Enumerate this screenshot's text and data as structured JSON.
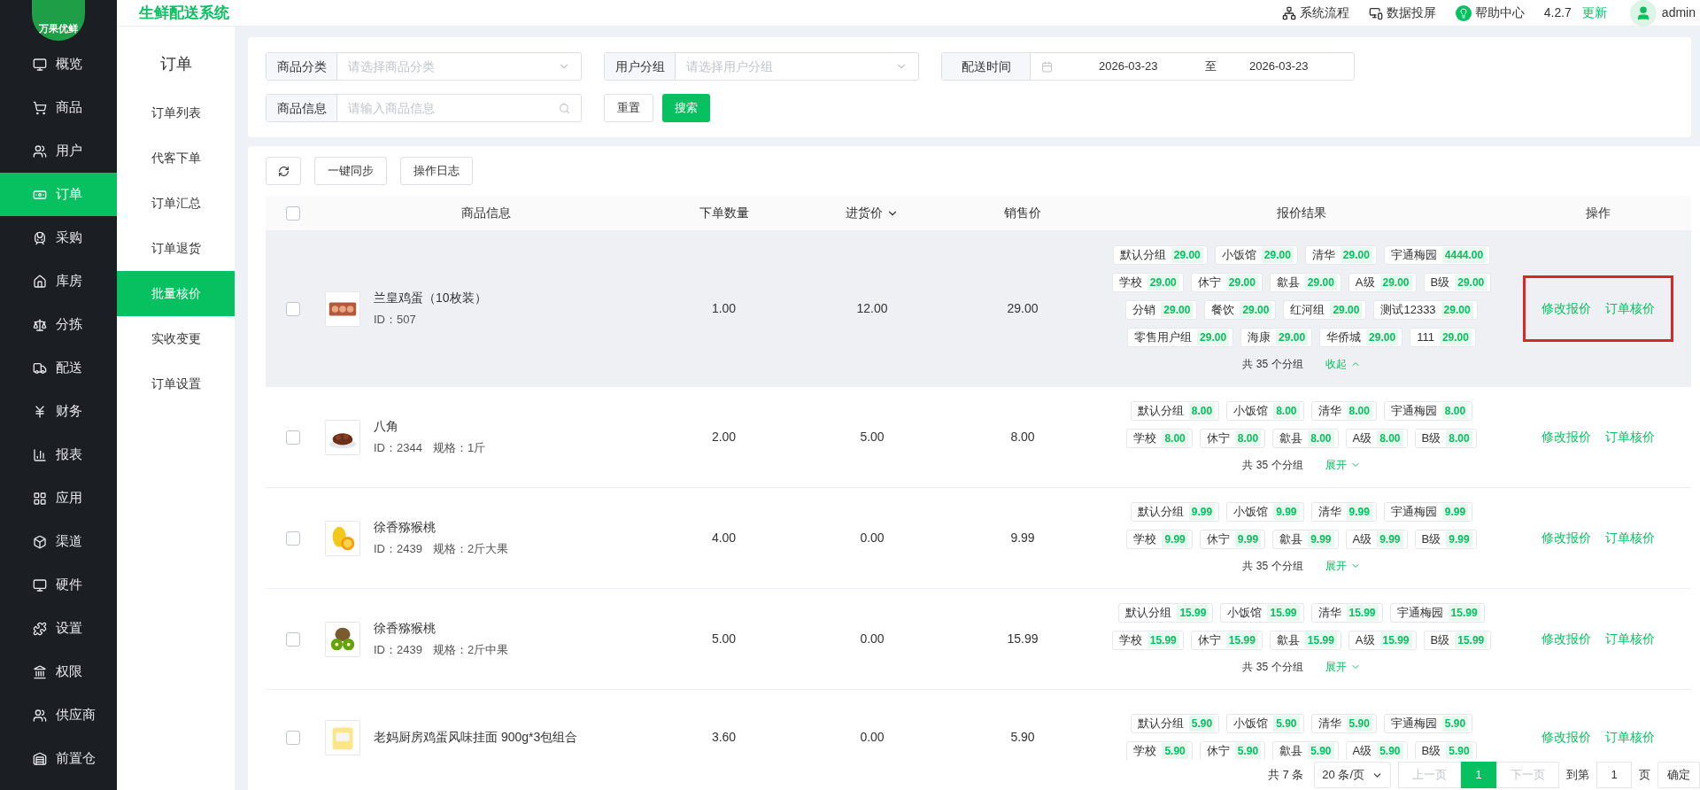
{
  "app": {
    "logo_text": "万果优鲜",
    "title": "生鲜配送系统"
  },
  "header": {
    "links": [
      "系统流程",
      "数据投屏",
      "帮助中心"
    ],
    "version": "4.2.7",
    "update": "更新",
    "user": "admin"
  },
  "sidebar": {
    "items": [
      {
        "label": "概览",
        "selected": false
      },
      {
        "label": "商品",
        "selected": false
      },
      {
        "label": "用户",
        "selected": false
      },
      {
        "label": "订单",
        "selected": true
      },
      {
        "label": "采购",
        "selected": false
      },
      {
        "label": "库房",
        "selected": false
      },
      {
        "label": "分拣",
        "selected": false
      },
      {
        "label": "配送",
        "selected": false
      },
      {
        "label": "财务",
        "selected": false
      },
      {
        "label": "报表",
        "selected": false
      },
      {
        "label": "应用",
        "selected": false
      },
      {
        "label": "渠道",
        "selected": false
      },
      {
        "label": "硬件",
        "selected": false
      },
      {
        "label": "设置",
        "selected": false
      },
      {
        "label": "权限",
        "selected": false
      },
      {
        "label": "供应商",
        "selected": false
      },
      {
        "label": "前置仓",
        "selected": false
      }
    ]
  },
  "subnav": {
    "title": "订单",
    "items": [
      {
        "label": "订单列表",
        "selected": false
      },
      {
        "label": "代客下单",
        "selected": false
      },
      {
        "label": "订单汇总",
        "selected": false
      },
      {
        "label": "订单退货",
        "selected": false
      },
      {
        "label": "批量核价",
        "selected": true
      },
      {
        "label": "实收变更",
        "selected": false
      },
      {
        "label": "订单设置",
        "selected": false
      }
    ]
  },
  "filters": {
    "category": {
      "label": "商品分类",
      "placeholder": "请选择商品分类"
    },
    "user_group": {
      "label": "用户分组",
      "placeholder": "请选择用户分组"
    },
    "delivery_time": {
      "label": "配送时间",
      "start": "2026-03-23",
      "separator": "至",
      "end": "2026-03-23"
    },
    "product": {
      "label": "商品信息",
      "placeholder": "请输入商品信息"
    },
    "reset": "重置",
    "search": "搜索"
  },
  "toolbar": {
    "buttons": [
      "一键同步",
      "操作日志"
    ]
  },
  "table": {
    "columns": [
      "商品信息",
      "下单数量",
      "进货价",
      "销售价",
      "报价结果",
      "操作"
    ],
    "header_checked": false,
    "rows": [
      {
        "checked": false,
        "hovered": true,
        "name": "兰皇鸡蛋（10枚装）",
        "id": "ID：507",
        "quantity": "1.00",
        "purchase_price": "12.00",
        "sale_price": "29.00",
        "groups": [
          {
            "name": "默认分组",
            "price": "29.00"
          },
          {
            "name": "小饭馆",
            "price": "29.00"
          },
          {
            "name": "清华",
            "price": "29.00"
          },
          {
            "name": "宇通梅园",
            "price": "4444.00"
          },
          {
            "name": "学校",
            "price": "29.00"
          },
          {
            "name": "休宁",
            "price": "29.00"
          },
          {
            "name": "歙县",
            "price": "29.00"
          },
          {
            "name": "A级",
            "price": "29.00"
          },
          {
            "name": "B级",
            "price": "29.00"
          },
          {
            "name": "分销",
            "price": "29.00"
          },
          {
            "name": "餐饮",
            "price": "29.00"
          },
          {
            "name": "红河组",
            "price": "29.00"
          },
          {
            "name": "测试12333",
            "price": "29.00"
          },
          {
            "name": "零售用户组",
            "price": "29.00"
          },
          {
            "name": "海康",
            "price": "29.00"
          },
          {
            "name": "华侨城",
            "price": "29.00"
          },
          {
            "name": "111",
            "price": "29.00"
          }
        ],
        "total": "共 35 个分组",
        "toggle": "收起",
        "expanded": true,
        "actions": [
          "修改报价",
          "订单核价"
        ],
        "highlighted": true
      },
      {
        "checked": false,
        "name": "八角",
        "id": "ID：2344",
        "spec": "规格：1斤",
        "quantity": "2.00",
        "purchase_price": "5.00",
        "sale_price": "8.00",
        "groups": [
          {
            "name": "默认分组",
            "price": "8.00"
          },
          {
            "name": "小饭馆",
            "price": "8.00"
          },
          {
            "name": "清华",
            "price": "8.00"
          },
          {
            "name": "宇通梅园",
            "price": "8.00"
          },
          {
            "name": "学校",
            "price": "8.00"
          },
          {
            "name": "休宁",
            "price": "8.00"
          },
          {
            "name": "歙县",
            "price": "8.00"
          },
          {
            "name": "A级",
            "price": "8.00"
          },
          {
            "name": "B级",
            "price": "8.00"
          }
        ],
        "total": "共 35 个分组",
        "toggle": "展开",
        "expanded": false,
        "actions": [
          "修改报价",
          "订单核价"
        ]
      },
      {
        "checked": false,
        "name": "徐香猕猴桃",
        "id": "ID：2439",
        "spec": "规格：2斤大果",
        "quantity": "4.00",
        "purchase_price": "0.00",
        "sale_price": "9.99",
        "groups": [
          {
            "name": "默认分组",
            "price": "9.99"
          },
          {
            "name": "小饭馆",
            "price": "9.99"
          },
          {
            "name": "清华",
            "price": "9.99"
          },
          {
            "name": "宇通梅园",
            "price": "9.99"
          },
          {
            "name": "学校",
            "price": "9.99"
          },
          {
            "name": "休宁",
            "price": "9.99"
          },
          {
            "name": "歙县",
            "price": "9.99"
          },
          {
            "name": "A级",
            "price": "9.99"
          },
          {
            "name": "B级",
            "price": "9.99"
          }
        ],
        "total": "共 35 个分组",
        "toggle": "展开",
        "expanded": false,
        "actions": [
          "修改报价",
          "订单核价"
        ]
      },
      {
        "checked": false,
        "name": "徐香猕猴桃",
        "id": "ID：2439",
        "spec": "规格：2斤中果",
        "quantity": "5.00",
        "purchase_price": "0.00",
        "sale_price": "15.99",
        "groups": [
          {
            "name": "默认分组",
            "price": "15.99"
          },
          {
            "name": "小饭馆",
            "price": "15.99"
          },
          {
            "name": "清华",
            "price": "15.99"
          },
          {
            "name": "宇通梅园",
            "price": "15.99"
          },
          {
            "name": "学校",
            "price": "15.99"
          },
          {
            "name": "休宁",
            "price": "15.99"
          },
          {
            "name": "歙县",
            "price": "15.99"
          },
          {
            "name": "A级",
            "price": "15.99"
          },
          {
            "name": "B级",
            "price": "15.99"
          }
        ],
        "total": "共 35 个分组",
        "toggle": "展开",
        "expanded": false,
        "actions": [
          "修改报价",
          "订单核价"
        ]
      },
      {
        "checked": false,
        "name": "老妈厨房鸡蛋风味挂面 900g*3包组合",
        "quantity": "3.60",
        "purchase_price": "0.00",
        "sale_price": "5.90",
        "groups": [
          {
            "name": "默认分组",
            "price": "5.90"
          },
          {
            "name": "小饭馆",
            "price": "5.90"
          },
          {
            "name": "清华",
            "price": "5.90"
          },
          {
            "name": "宇通梅园",
            "price": "5.90"
          },
          {
            "name": "学校",
            "price": "5.90"
          },
          {
            "name": "休宁",
            "price": "5.90"
          },
          {
            "name": "歙县",
            "price": "5.90"
          },
          {
            "name": "A级",
            "price": "5.90"
          },
          {
            "name": "B级",
            "price": "5.90"
          }
        ],
        "actions": [
          "修改报价",
          "订单核价"
        ]
      }
    ]
  },
  "pagination": {
    "total": "共 7 条",
    "page_size": "20 条/页",
    "prev": {
      "label": "上一页",
      "disabled": true
    },
    "pages": [
      {
        "label": "1",
        "selected": true
      }
    ],
    "next": {
      "label": "下一页",
      "disabled": true
    },
    "goto_label": "到第",
    "goto_value": "1",
    "page_suffix": "页",
    "confirm": "确定"
  }
}
